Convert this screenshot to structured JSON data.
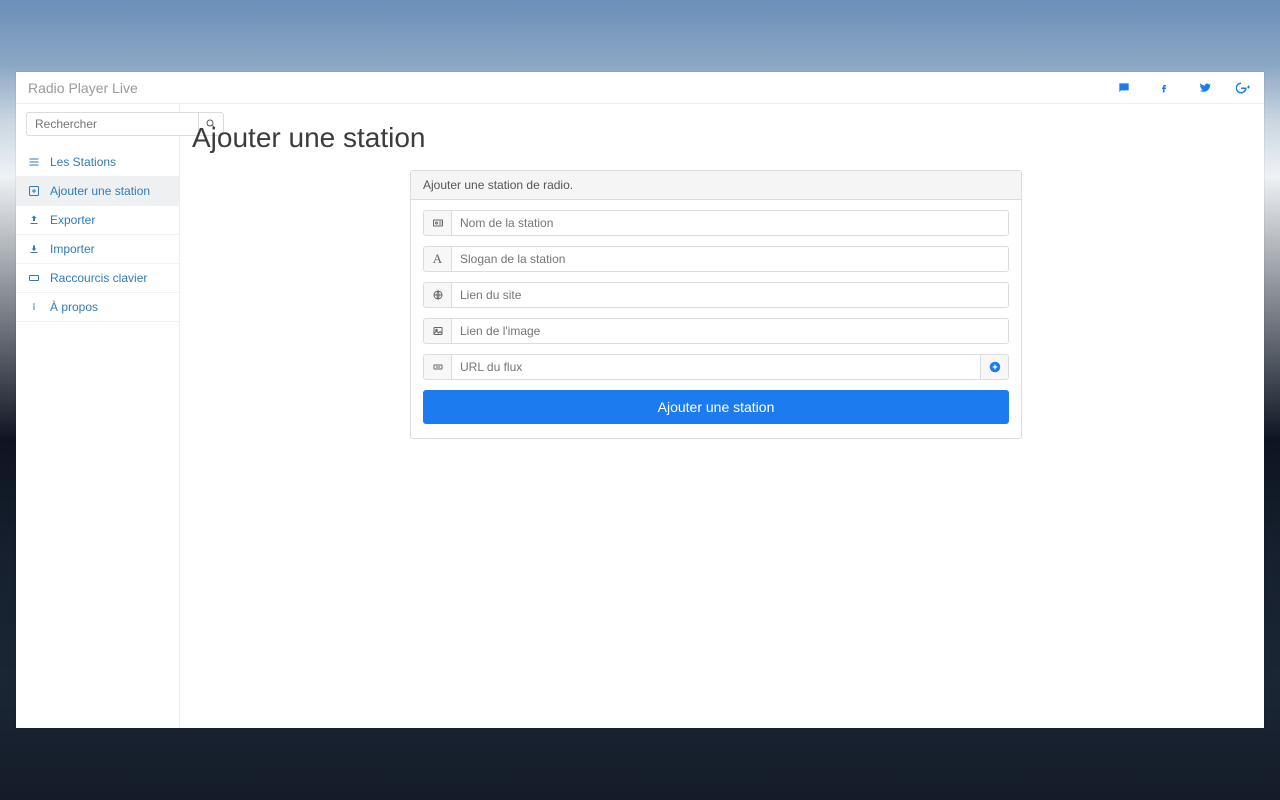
{
  "brand": "Radio Player Live",
  "search": {
    "placeholder": "Rechercher"
  },
  "nav": {
    "stations": "Les Stations",
    "add": "Ajouter une station",
    "export": "Exporter",
    "import": "Importer",
    "shortcuts": "Raccourcis clavier",
    "about": "À propos"
  },
  "page": {
    "title": "Ajouter une station"
  },
  "form": {
    "panel_title": "Ajouter une station de radio.",
    "name_placeholder": "Nom de la station",
    "slogan_placeholder": "Slogan de la station",
    "site_placeholder": "Lien du site",
    "image_placeholder": "Lien de l'image",
    "flux_placeholder": "URL du flux",
    "submit": "Ajouter une station"
  }
}
